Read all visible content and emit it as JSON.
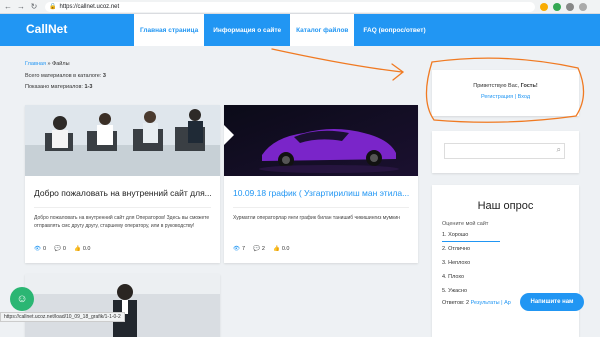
{
  "browser": {
    "url": "https://callnet.ucoz.net"
  },
  "site": {
    "logo": "CallNet"
  },
  "menu": [
    {
      "label": "Главная страница",
      "style": "light"
    },
    {
      "label": "Информация о сайте",
      "style": "dark"
    },
    {
      "label": "Каталог файлов",
      "style": "light"
    },
    {
      "label": "FAQ (вопрос/ответ)",
      "style": "dark"
    }
  ],
  "breadcrumb": {
    "home": "Главная",
    "sep": "»",
    "current": "Файлы"
  },
  "catalog": {
    "total_label": "Всего материалов в каталоге:",
    "total_value": "3",
    "shown_label": "Показано материалов:",
    "shown_value": "1-3"
  },
  "cards": [
    {
      "title": "Добро пожаловать на внутренний сайт для...",
      "text": "Добро пожаловать на внутренний сайт для Операторов! Здесь вы сможете отправлять смс другу другу, старшему оператору, или в руководству!",
      "views": "0",
      "comments": "0",
      "rating": "0.0"
    },
    {
      "title": "10.09.18 график ( Узгартирилиш ман этила...",
      "text": "Хурматли операторлар янги график билан танишиб чикишингиз мумкин",
      "views": "7",
      "comments": "2",
      "rating": "0.0"
    }
  ],
  "sidebar": {
    "greeting_prefix": "Приветствую Вас,",
    "greeting_name": "Гость!",
    "register": "Регистрация",
    "login_sep": "|",
    "login": "Вход",
    "poll": {
      "title": "Наш опрос",
      "question": "Оцените мой сайт",
      "options": [
        "1. Хорошо",
        "2. Отлично",
        "3. Неплохо",
        "4. Плохо",
        "5. Ужасно"
      ],
      "footer_prefix": "Ответов:",
      "footer_count": "2",
      "results": "Результаты",
      "footer_tail": "| Ар"
    }
  },
  "status_url": "https://callnet.ucoz.net/load/10_09_18_grafik/1-1-0-2",
  "chat_button": "Напишите нам",
  "colors": {
    "header": "#2196f3",
    "accent": "#2196f3",
    "annotation": "#f07a22",
    "fab": "#2bb673"
  }
}
